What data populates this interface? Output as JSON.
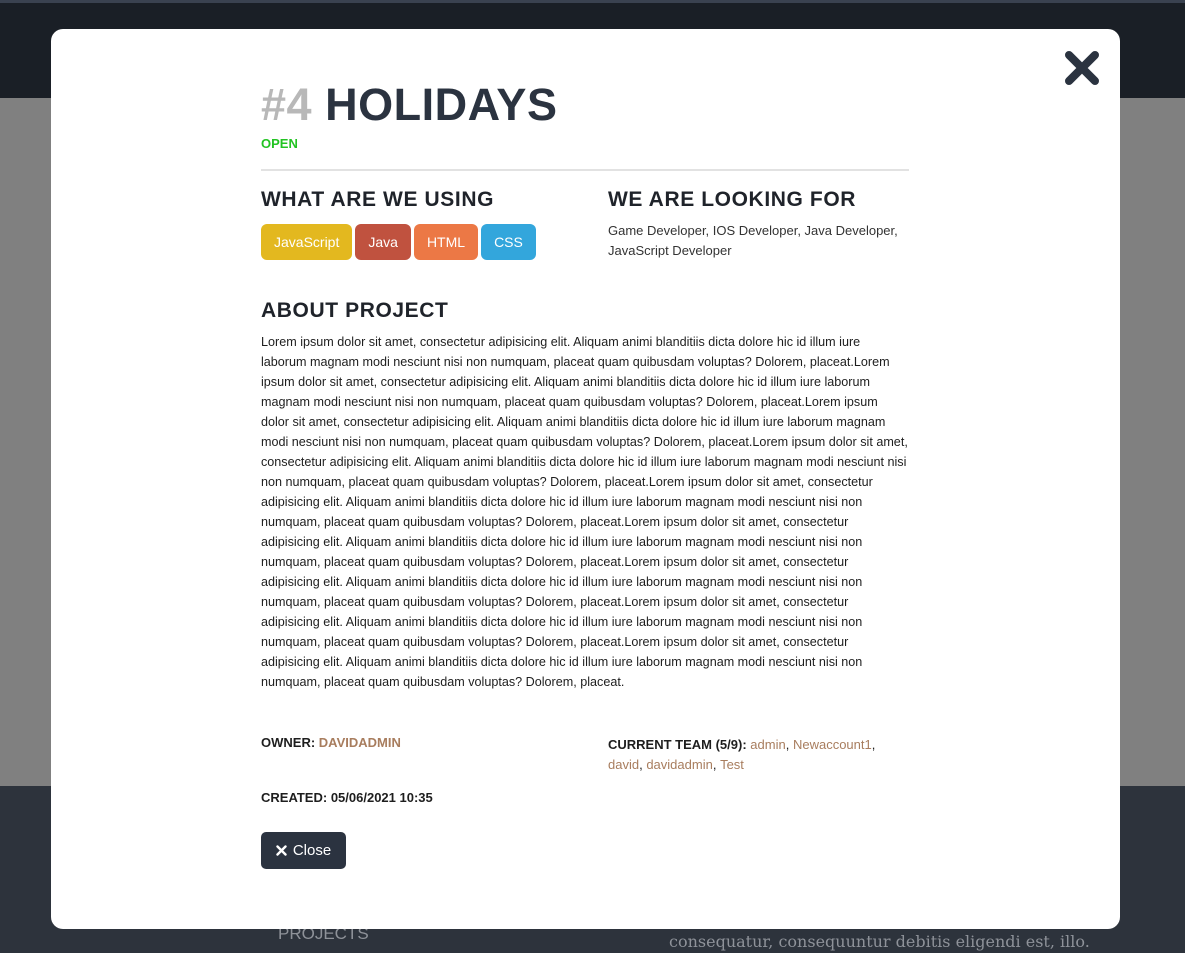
{
  "background": {
    "footer_projects": "PROJECTS",
    "footer_text": "consequatur, consequuntur debitis eligendi est, illo."
  },
  "modal": {
    "title_number": "#4",
    "title_name": "HOLIDAYS",
    "status": "OPEN",
    "using_heading": "WHAT ARE WE USING",
    "tags": [
      {
        "label": "JavaScript",
        "color": "#e3b81f"
      },
      {
        "label": "Java",
        "color": "#c0523f"
      },
      {
        "label": "HTML",
        "color": "#ec7845"
      },
      {
        "label": "CSS",
        "color": "#33a6dc"
      }
    ],
    "looking_heading": "WE ARE LOOKING FOR",
    "looking_text": "Game Developer, IOS Developer, Java Developer, JavaScript Developer",
    "about_heading": "ABOUT PROJECT",
    "about_text": "Lorem ipsum dolor sit amet, consectetur adipisicing elit. Aliquam animi blanditiis dicta dolore hic id illum iure laborum magnam modi nesciunt nisi non numquam, placeat quam quibusdam voluptas? Dolorem, placeat.Lorem ipsum dolor sit amet, consectetur adipisicing elit. Aliquam animi blanditiis dicta dolore hic id illum iure laborum magnam modi nesciunt nisi non numquam, placeat quam quibusdam voluptas? Dolorem, placeat.Lorem ipsum dolor sit amet, consectetur adipisicing elit. Aliquam animi blanditiis dicta dolore hic id illum iure laborum magnam modi nesciunt nisi non numquam, placeat quam quibusdam voluptas? Dolorem, placeat.Lorem ipsum dolor sit amet, consectetur adipisicing elit. Aliquam animi blanditiis dicta dolore hic id illum iure laborum magnam modi nesciunt nisi non numquam, placeat quam quibusdam voluptas? Dolorem, placeat.Lorem ipsum dolor sit amet, consectetur adipisicing elit. Aliquam animi blanditiis dicta dolore hic id illum iure laborum magnam modi nesciunt nisi non numquam, placeat quam quibusdam voluptas? Dolorem, placeat.Lorem ipsum dolor sit amet, consectetur adipisicing elit. Aliquam animi blanditiis dicta dolore hic id illum iure laborum magnam modi nesciunt nisi non numquam, placeat quam quibusdam voluptas? Dolorem, placeat.Lorem ipsum dolor sit amet, consectetur adipisicing elit. Aliquam animi blanditiis dicta dolore hic id illum iure laborum magnam modi nesciunt nisi non numquam, placeat quam quibusdam voluptas? Dolorem, placeat.Lorem ipsum dolor sit amet, consectetur adipisicing elit. Aliquam animi blanditiis dicta dolore hic id illum iure laborum magnam modi nesciunt nisi non numquam, placeat quam quibusdam voluptas? Dolorem, placeat.Lorem ipsum dolor sit amet, consectetur adipisicing elit. Aliquam animi blanditiis dicta dolore hic id illum iure laborum magnam modi nesciunt nisi non numquam, placeat quam quibusdam voluptas? Dolorem, placeat.",
    "owner_label": "OWNER:",
    "owner_name": "DAVIDADMIN",
    "team_label": "CURRENT TEAM (5/9):",
    "team_members": [
      "admin",
      "Newaccount1",
      "david",
      "davidadmin",
      "Test"
    ],
    "created_label": "CREATED:",
    "created_value": "05/06/2021 10:35",
    "close_label": "Close"
  }
}
